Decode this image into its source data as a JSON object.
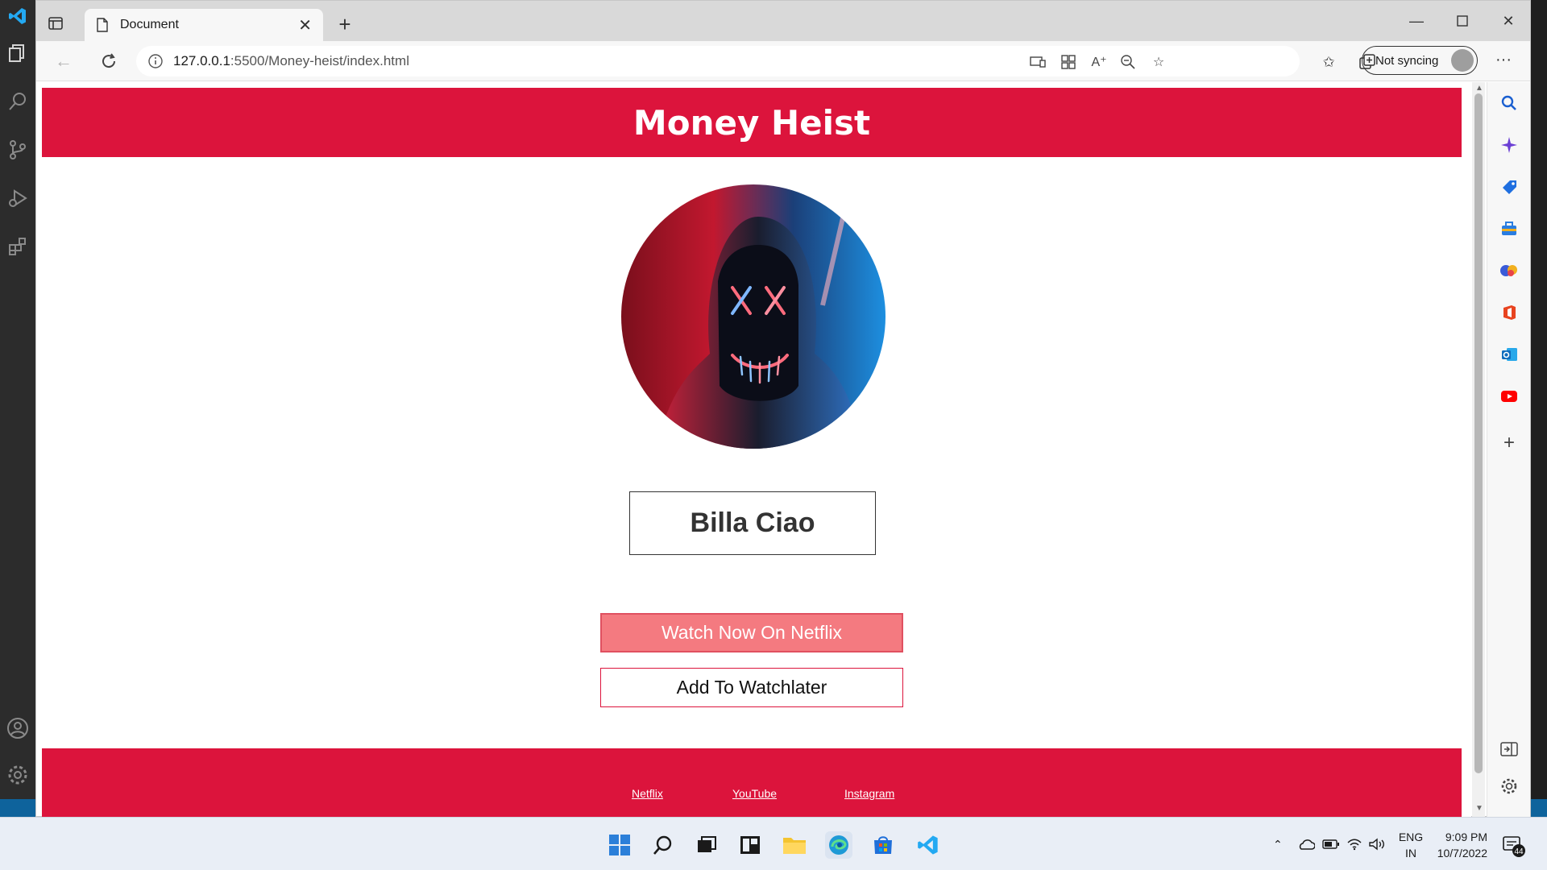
{
  "browser": {
    "tab_title": "Document",
    "url_host": "127.0.0.1",
    "url_path": ":5500/Money-heist/index.html",
    "sync_label": "Not syncing"
  },
  "page": {
    "header_title": "Money Heist",
    "name_text": "Billa Ciao",
    "watch_button": "Watch Now On Netflix",
    "later_button": "Add To Watchlater",
    "footer_links": [
      "Netflix",
      "YouTube",
      "Instagram"
    ]
  },
  "taskbar": {
    "lang_line1": "ENG",
    "lang_line2": "IN",
    "time": "9:09 PM",
    "date": "10/7/2022",
    "notif_count": "44"
  },
  "colors": {
    "brand_red": "#dc143c",
    "watch_bg": "#f47a80"
  }
}
